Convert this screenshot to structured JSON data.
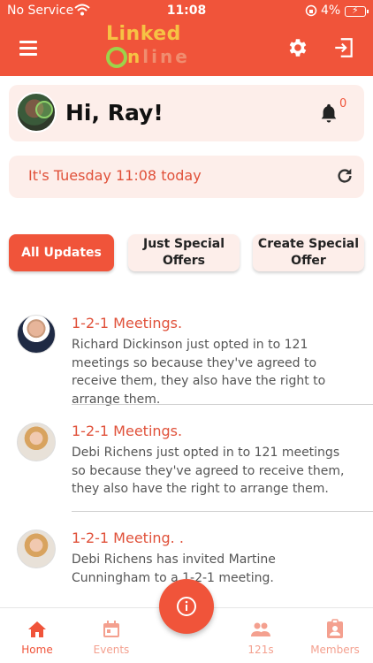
{
  "status_bar": {
    "carrier": "No Service",
    "time": "11:08",
    "battery": "4%"
  },
  "header": {
    "logo_line1": "Linked",
    "logo_line2_a": "n",
    "logo_line2_b": "line"
  },
  "greeting": {
    "text": "Hi, Ray!",
    "notification_count": "0"
  },
  "date_card": {
    "text": "It's Tuesday 11:08 today"
  },
  "filters": [
    {
      "label": "All Updates",
      "active": true
    },
    {
      "label": "Just Special Offers",
      "active": false
    },
    {
      "label": "Create Special Offer",
      "active": false
    }
  ],
  "feed": [
    {
      "title": "1-2-1 Meetings.",
      "body": "Richard Dickinson just opted in to 121 meetings so because they've agreed to receive them, they also have the right to arrange them."
    },
    {
      "title": "1-2-1 Meetings.",
      "body": "Debi Richens just opted in to 121 meetings so because they've agreed to receive them, they also have the right to arrange them."
    },
    {
      "title": "1-2-1 Meeting. .",
      "body": "Debi Richens has invited Martine Cunningham to a 1-2-1 meeting."
    }
  ],
  "bottom_nav": [
    {
      "label": "Home",
      "icon": "home-icon",
      "active": true
    },
    {
      "label": "Events",
      "icon": "calendar-icon",
      "active": false
    },
    {
      "label": "121s",
      "icon": "people-icon",
      "active": false
    },
    {
      "label": "Members",
      "icon": "badge-icon",
      "active": false
    }
  ],
  "colors": {
    "accent": "#f0543a",
    "card_bg": "#fdeeea",
    "logo_yellow": "#f6c244",
    "logo_green": "#9dd34a"
  }
}
